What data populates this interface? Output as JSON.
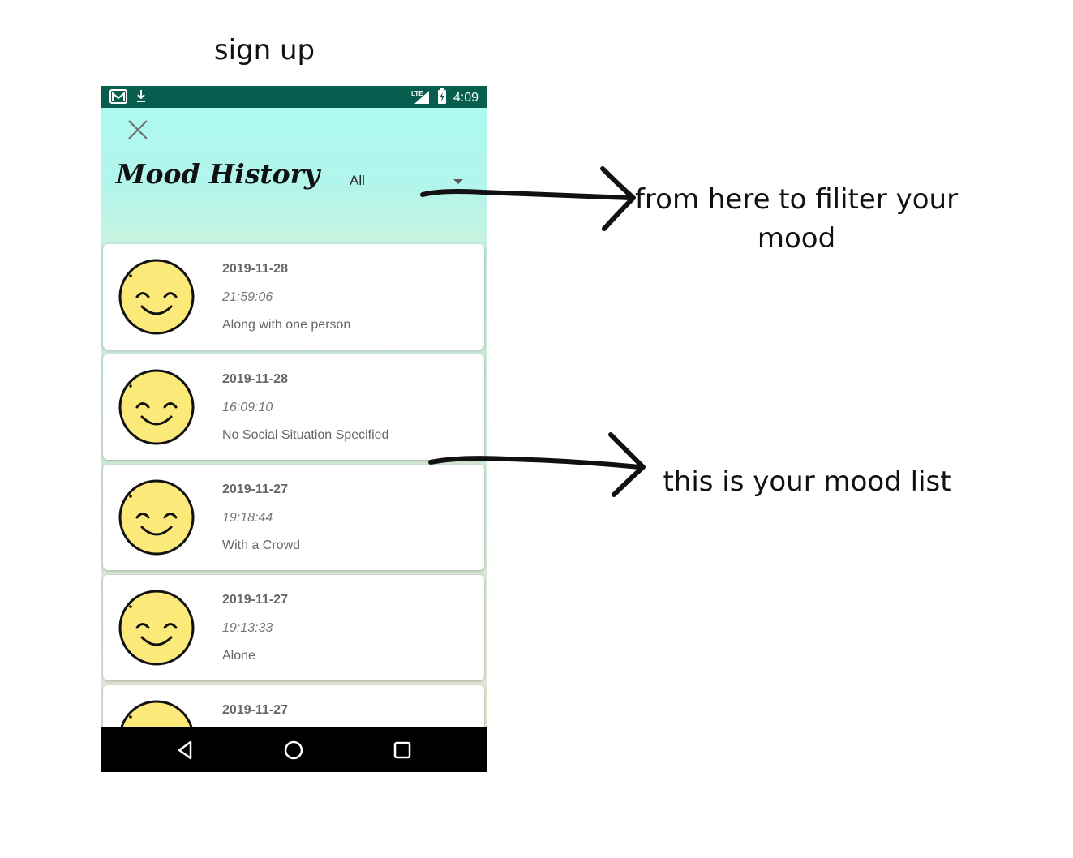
{
  "slide": {
    "title": "sign up",
    "annotation_filter": "from here to filiter your mood",
    "annotation_list": "this is your mood list"
  },
  "status_bar": {
    "time": "4:09",
    "left_icons": [
      "gmail-icon",
      "download-icon"
    ],
    "right_icons": [
      "lte-signal-icon",
      "battery-charging-icon"
    ]
  },
  "header": {
    "title": "Mood History",
    "filter_value": "All",
    "close_icon": "close-icon"
  },
  "moods": [
    {
      "date": "2019-11-28",
      "time": "21:59:06",
      "situation": "Along with one person",
      "icon": "smiley-face-icon"
    },
    {
      "date": "2019-11-28",
      "time": "16:09:10",
      "situation": "No Social Situation Specified",
      "icon": "smiley-face-icon"
    },
    {
      "date": "2019-11-27",
      "time": "19:18:44",
      "situation": "With a Crowd",
      "icon": "smiley-face-icon"
    },
    {
      "date": "2019-11-27",
      "time": "19:13:33",
      "situation": "Alone",
      "icon": "smiley-face-icon"
    },
    {
      "date": "2019-11-27",
      "time": "",
      "situation": "",
      "icon": "smiley-face-icon"
    }
  ],
  "nav": {
    "icons": [
      "back-icon",
      "home-icon",
      "recents-icon"
    ]
  },
  "colors": {
    "status_bar": "#075e4f",
    "header_gradient_top": "#aef9f0",
    "face_fill": "#fbe97a",
    "nav_bar": "#000000"
  }
}
